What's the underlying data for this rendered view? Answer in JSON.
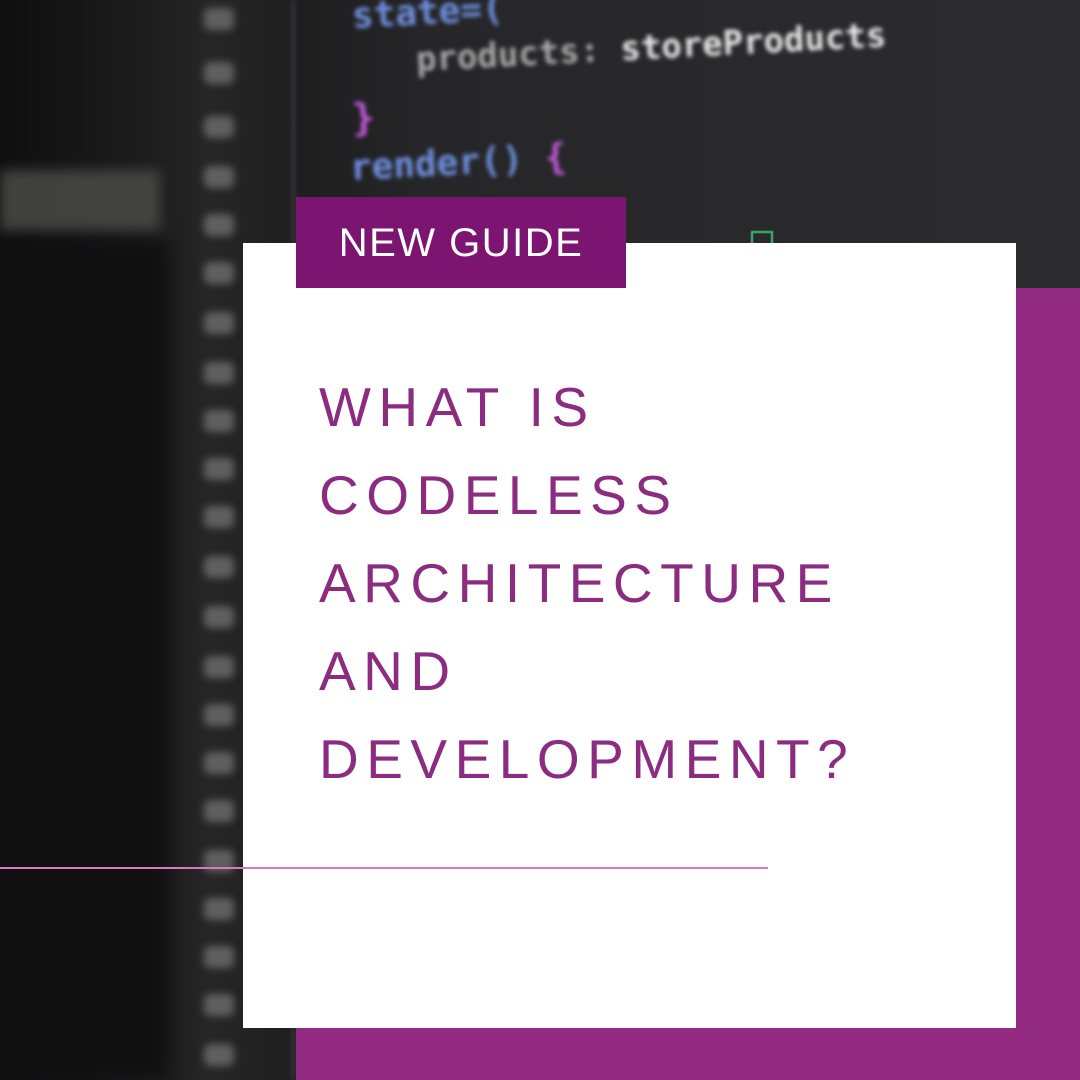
{
  "badge": {
    "label": "NEW GUIDE"
  },
  "headline": {
    "lines": [
      "WHAT IS",
      "CODELESS",
      "ARCHITECTURE",
      "AND",
      "DEVELOPMENT?"
    ]
  },
  "background_code": {
    "lines": [
      [
        "state=(",
        ""
      ],
      [
        "products:",
        "storeProducts"
      ],
      [
        "}",
        ""
      ],
      [
        "render()",
        "{"
      ]
    ]
  },
  "colors": {
    "brand_purple": "#922a81",
    "badge_purple": "#7b1571",
    "headline_purple": "#8b2c80",
    "accent_pink": "#d77ac5",
    "card_white": "#ffffff"
  }
}
